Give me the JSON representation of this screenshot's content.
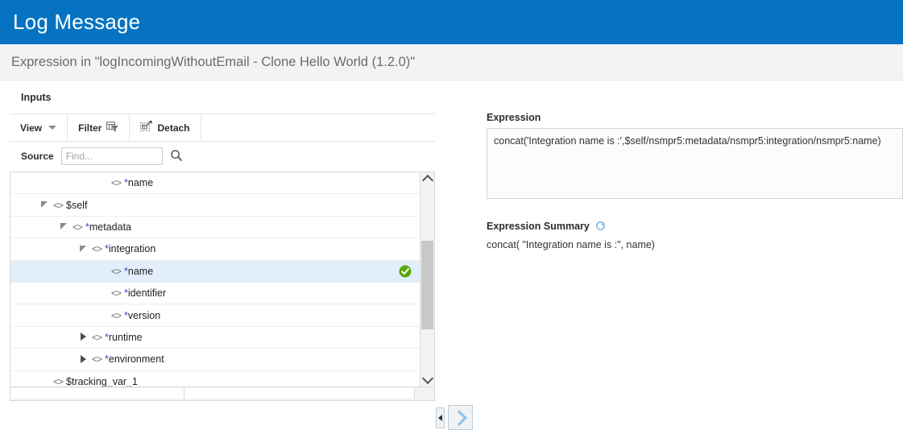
{
  "window": {
    "title": "Log Message",
    "subtitle": "Expression in \"logIncomingWithoutEmail - Clone Hello World (1.2.0)\""
  },
  "colors": {
    "header_blue": "#0673c2",
    "subbar_bg": "#f3f3f4",
    "selected_row": "#e2eef9",
    "check_green": "#5aa80a",
    "chevron_blue": "#8cc0e8",
    "star_blue": "#3b43c9"
  },
  "left_panel": {
    "heading": "Inputs",
    "toolbar": {
      "view_label": "View",
      "filter_label": "Filter",
      "detach_label": "Detach"
    },
    "find": {
      "label": "Source",
      "placeholder": "Find...",
      "value": "",
      "search_icon": "search-icon"
    },
    "tree": [
      {
        "label": "*name",
        "indent": 4,
        "twisty": "none",
        "selected": false,
        "valid": false
      },
      {
        "label": "$self",
        "indent": 1,
        "twisty": "open",
        "selected": false,
        "valid": false
      },
      {
        "label": "*metadata",
        "indent": 2,
        "twisty": "open",
        "selected": false,
        "valid": false
      },
      {
        "label": "*integration",
        "indent": 3,
        "twisty": "open",
        "selected": false,
        "valid": false
      },
      {
        "label": "*name",
        "indent": 4,
        "twisty": "none",
        "selected": true,
        "valid": true
      },
      {
        "label": "*identifier",
        "indent": 4,
        "twisty": "none",
        "selected": false,
        "valid": false
      },
      {
        "label": "*version",
        "indent": 4,
        "twisty": "none",
        "selected": false,
        "valid": false
      },
      {
        "label": "*runtime",
        "indent": 3,
        "twisty": "closed",
        "selected": false,
        "valid": false
      },
      {
        "label": "*environment",
        "indent": 3,
        "twisty": "closed",
        "selected": false,
        "valid": false
      },
      {
        "label": "$tracking_var_1",
        "indent": 1,
        "twisty": "none",
        "selected": false,
        "valid": false
      }
    ]
  },
  "center": {
    "collapse_handle": "splitter-collapse-handle",
    "move_button": "move-right-button"
  },
  "right_panel": {
    "expression_label": "Expression",
    "expression_value": "concat('Integration name is :',$self/nsmpr5:metadata/nsmpr5:integration/nsmpr5:name)",
    "summary_label": "Expression Summary",
    "summary_icon": "refresh-icon",
    "summary_text": "concat( \"Integration name is :\", name)"
  }
}
